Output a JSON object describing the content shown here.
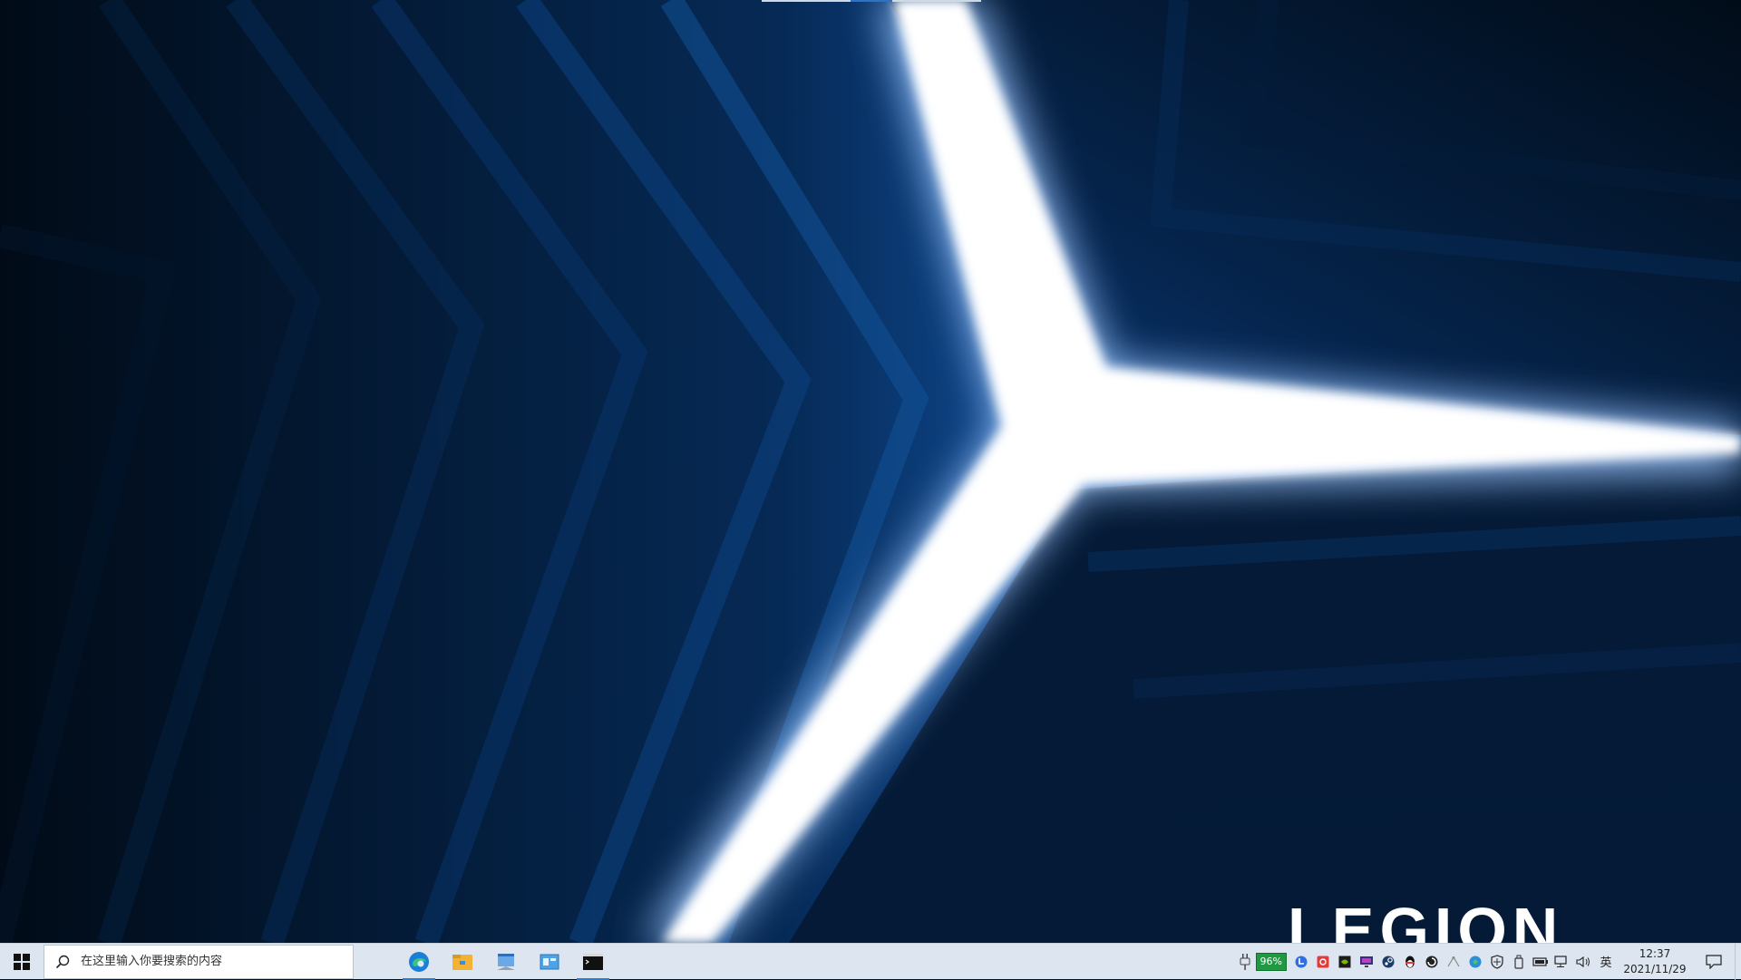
{
  "wallpaper": {
    "brand_text": "LEGION",
    "colors": {
      "deep": "#02101f",
      "mid": "#0b3d7a",
      "bright": "#1c5fb5",
      "glow": "#ffffff"
    }
  },
  "taskbar": {
    "search": {
      "placeholder": "在这里输入你要搜索的内容"
    },
    "apps": [
      {
        "name": "edge-icon",
        "running": true
      },
      {
        "name": "file-explorer-icon",
        "running": false
      },
      {
        "name": "app-window-icon",
        "running": false
      },
      {
        "name": "control-panel-icon",
        "running": false
      },
      {
        "name": "terminal-icon",
        "running": true
      }
    ],
    "tray": {
      "battery_percent": "96%",
      "ime_label": "英",
      "time": "12:37",
      "date": "2021/11/29"
    }
  }
}
